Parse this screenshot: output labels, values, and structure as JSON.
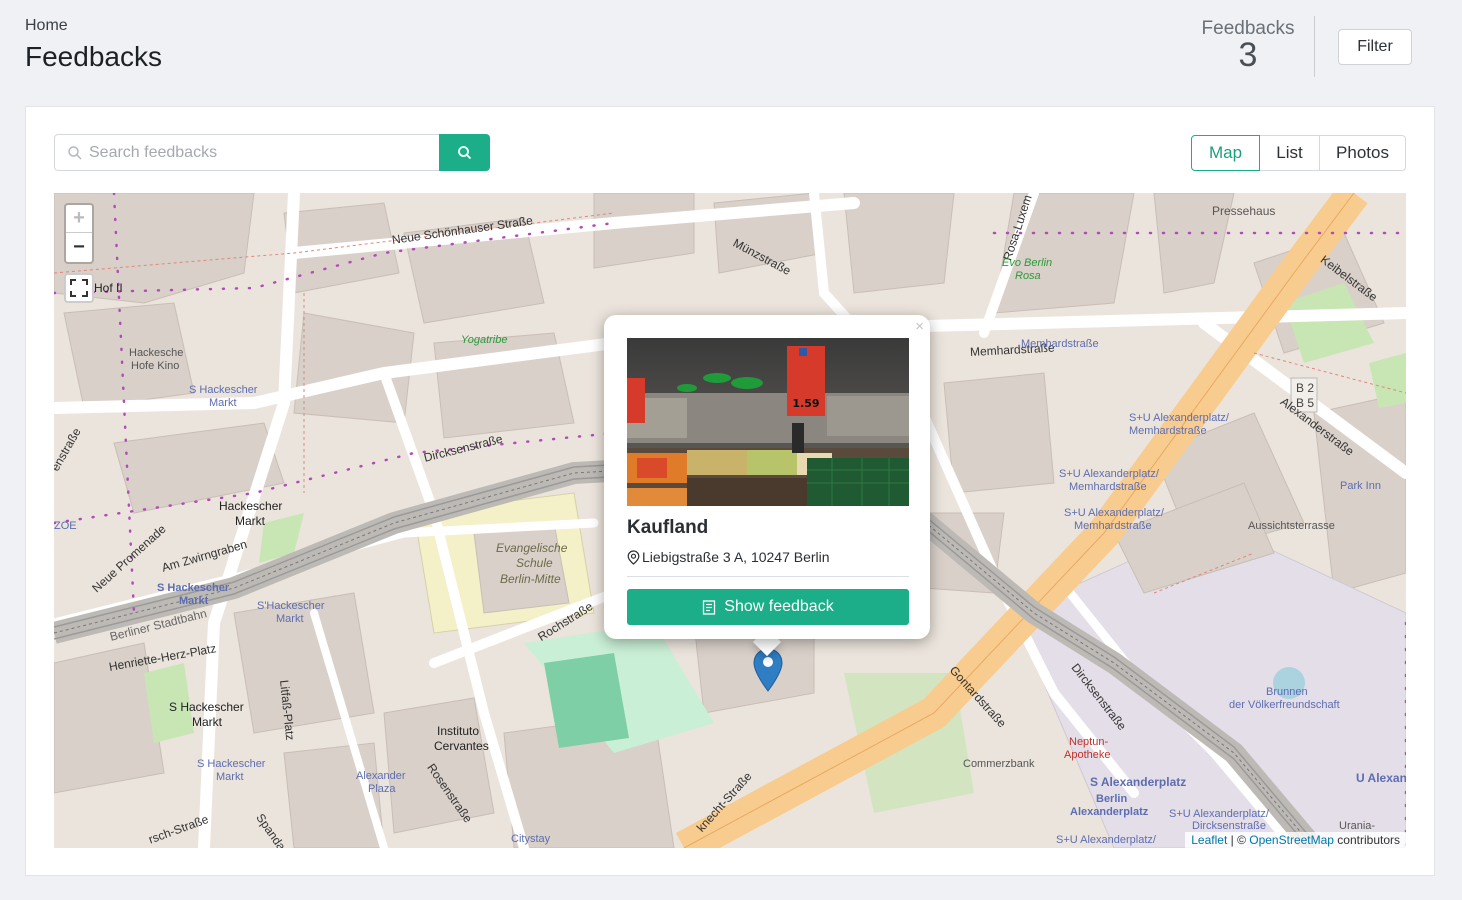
{
  "breadcrumb": "Home",
  "page_title": "Feedbacks",
  "stat": {
    "label": "Feedbacks",
    "value": "3"
  },
  "filter_label": "Filter",
  "search": {
    "placeholder": "Search feedbacks"
  },
  "views": [
    {
      "label": "Map",
      "active": true
    },
    {
      "label": "List",
      "active": false
    },
    {
      "label": "Photos",
      "active": false
    }
  ],
  "map": {
    "zoom_in": "+",
    "zoom_out": "−",
    "popup": {
      "close": "×",
      "title": "Kaufland",
      "address": "Liebigstraße 3 A, 10247 Berlin",
      "button": "Show feedback",
      "photo_price": "1.59"
    },
    "attribution": {
      "leaflet": "Leaflet",
      "sep": " | © ",
      "osm": "OpenStreetMap",
      "suffix": " contributors"
    },
    "streets": {
      "neue_schoenhauser": "Neue Schönhauser Straße",
      "muenzstrasse": "Münzstraße",
      "memhardstrasse": "Memhardstraße",
      "rosa_luxemburg": "Rosa-Luxem",
      "dircksenstrasse": "Dircksenstraße",
      "dircksenstrasse_2": "Dircksenstraße",
      "rochstrasse": "Rochstraße",
      "neue_promenade": "Neue Promenade",
      "am_zwirngraben": "Am Zwirngraben",
      "berliner_stadtbahn": "Berliner Stadtbahn",
      "henriette_herz_platz": "Henriette-Herz-Platz",
      "litfass_platz": "Litfaß-Platz",
      "rosenstrasse": "Rosenstraße",
      "alexanderstrasse": "Alexanderstraße",
      "keibelstrasse": "Keibelstraße",
      "gontardstrasse": "Gontardstraße",
      "spandauer": "Spandau",
      "karl_liebknecht": "knecht-Straße",
      "anienburger": "rsch-Straße",
      "burgstrasse": "enstraße"
    },
    "labels": {
      "hof_ii": "Hof II",
      "hackesche_hofe_kino_1": "Hackesche",
      "hackesche_hofe_kino_2": "Hofe Kino",
      "s_hackescher_markt_1": "S Hackescher",
      "s_hackescher_markt_2": "Markt",
      "yogatribe": "Yogatribe",
      "hackescher_markt_1": "Hackescher",
      "hackescher_markt_2": "Markt",
      "evangelische_1": "Evangelische",
      "evangelische_2": "Schule",
      "evangelische_3": "Berlin-Mitte",
      "s_hackescher_markt_b1": "S Hackescher",
      "s_hackescher_markt_b2": "Markt",
      "s_hackescher_markt_c1": "S Hackescher",
      "s_hackescher_markt_c2": "Markt",
      "s_hackescher_markt_d1": "S Hackescher",
      "s_hackescher_markt_d2": "Markt",
      "s_hackescher_markt_e1": "S'Hackescher",
      "s_hackescher_markt_e2": "Markt",
      "instituto_1": "Instituto",
      "instituto_2": "Cervantes",
      "alexander_plaza_1": "Alexander",
      "alexander_plaza_2": "Plaza",
      "citystay": "Citystay",
      "zoe": "ZOE",
      "pressehaus": "Pressehaus",
      "evo_berlin_1": "Evo Berlin",
      "evo_berlin_2": "Rosa",
      "memhardstrasse_stop": "Memhardstraße",
      "su_alex_memhard_1a": "S+U Alexanderplatz/",
      "su_alex_memhard_1b": "Memhardstraße",
      "su_alex_memhard_2a": "S+U Alexanderplatz/",
      "su_alex_memhard_2b": "Memhardstraße",
      "su_alex_memhard_3a": "S+U Alexanderplatz/",
      "su_alex_memhard_3b": "Memhardstraße",
      "park_inn": "Park Inn",
      "aussichtsterrasse": "Aussichtsterrasse",
      "b2": "B 2",
      "b5": "B 5",
      "brunnen_1": "Brunnen",
      "brunnen_2": "der Völkerfreundschaft",
      "neptun_1": "Neptun-",
      "neptun_2": "Apotheke",
      "commerzbank": "Commerzbank",
      "s_alexanderplatz": "S Alexanderplatz",
      "berlin_alexanderplatz_1": "Berlin",
      "berlin_alexanderplatz_2": "Alexanderplatz",
      "su_alex_dircksen_1": "S+U Alexanderplatz/",
      "su_alex_dircksen_2": "Dircksenstraße",
      "su_alexanderplatz_bottom": "S+U Alexanderplatz/",
      "u_alex": "U Alexan",
      "urania": "Urania-"
    }
  }
}
